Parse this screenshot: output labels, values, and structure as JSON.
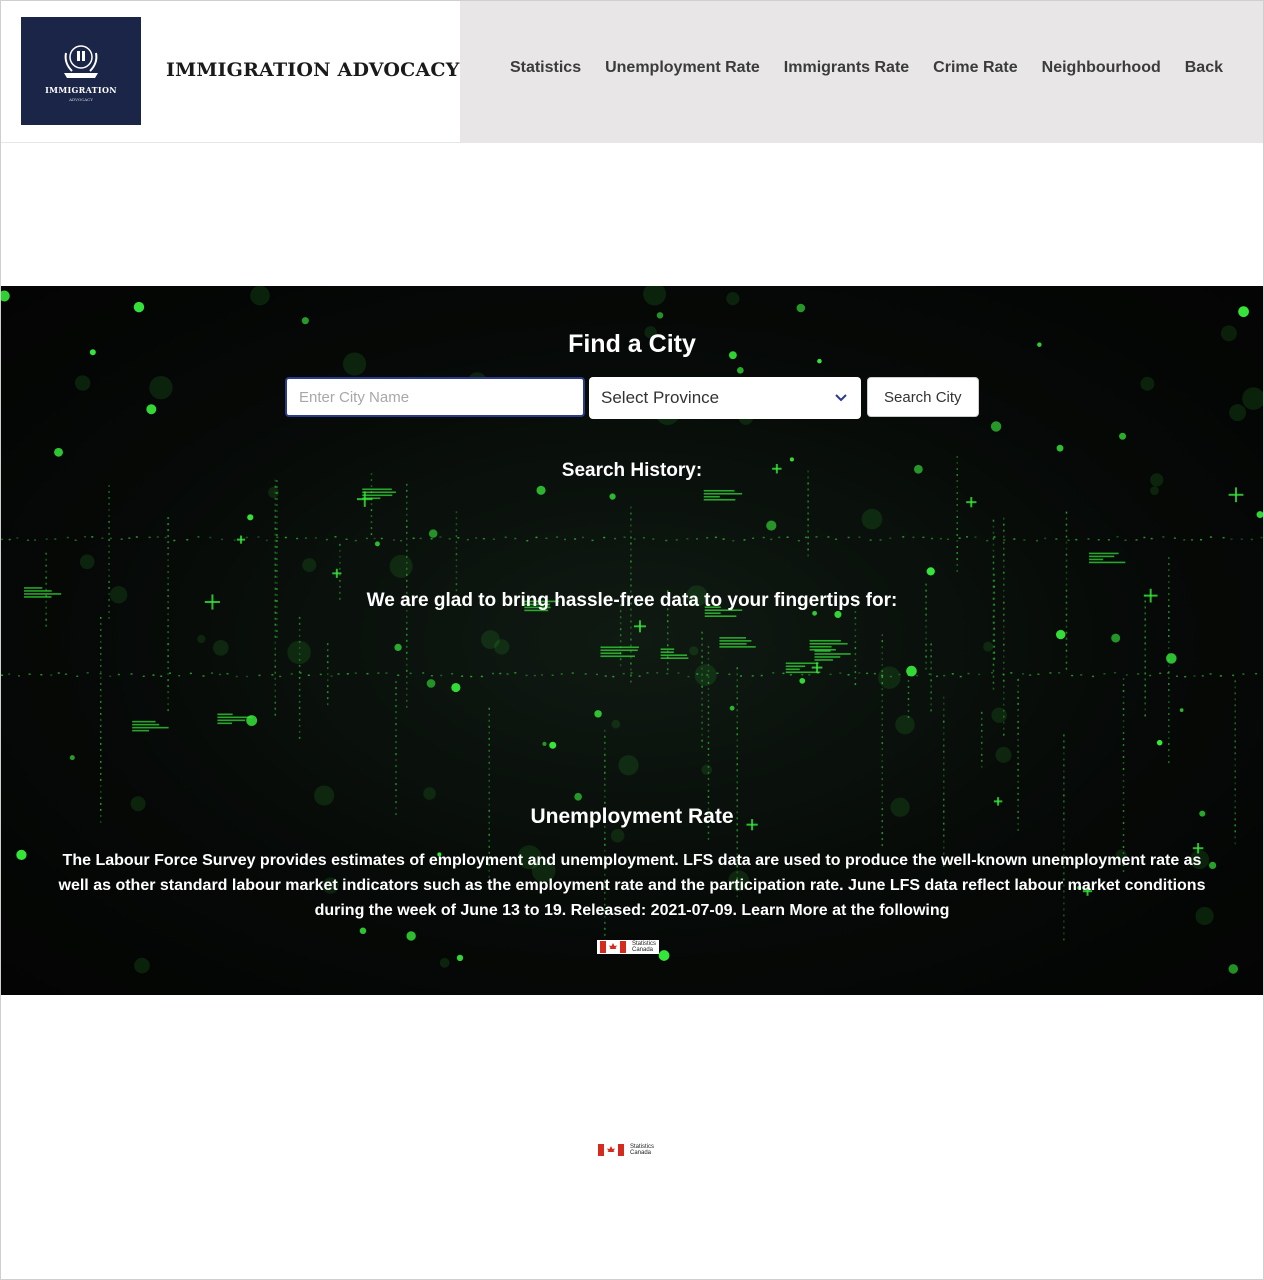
{
  "header": {
    "logo_text": "IMMIGRATION",
    "logo_sub": "ADVOCACY",
    "site_title": "IMMIGRATION ADVOCACY",
    "nav": [
      "Statistics",
      "Unemployment Rate",
      "Immigrants Rate",
      "Crime Rate",
      "Neighbourhood",
      "Back"
    ]
  },
  "hero": {
    "title": "Find a City",
    "city_placeholder": "Enter City Name",
    "province_selected": "Select Province",
    "search_button": "Search City",
    "history_label": "Search History:",
    "tagline": "We are glad to bring hassle-free data to your fingertips for:",
    "unemployment_title": "Unemployment Rate",
    "unemployment_text": "The Labour Force Survey provides estimates of employment and unemployment. LFS data are used to produce the well-known unemployment rate as well as other standard labour market indicators such as the employment rate and the participation rate. June LFS data reflect labour market conditions during the week of June 13 to 19. Released: 2021-07-09. Learn More at the following"
  },
  "statcan": {
    "line1": "Statistics",
    "line2": "Canada"
  },
  "colors": {
    "nav_bg": "#e8e6e7",
    "logo_bg": "#1b2547",
    "accent_green": "#37e83a",
    "input_border": "#2b3a8a"
  }
}
